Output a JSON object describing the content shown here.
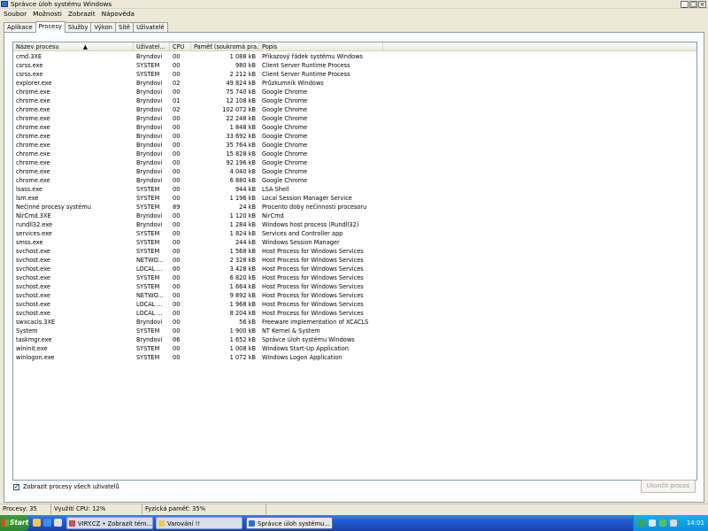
{
  "window": {
    "title": "Správce úloh systému Windows",
    "controls": [
      "_",
      "□",
      "×"
    ]
  },
  "menu": [
    "Soubor",
    "Možnosti",
    "Zobrazit",
    "Nápověda"
  ],
  "tabs": [
    {
      "label": "Aplikace"
    },
    {
      "label": "Procesy"
    },
    {
      "label": "Služby"
    },
    {
      "label": "Výkon"
    },
    {
      "label": "Sítě"
    },
    {
      "label": "Uživatelé"
    }
  ],
  "columns": {
    "name": "Název procesu",
    "sort_indicator": "▲",
    "user": "Uživatel...",
    "cpu": "CPU",
    "mem": "Paměť (soukromá pra...",
    "desc": "Popis"
  },
  "rows": [
    {
      "name": "cmd.3XE",
      "user": "Bryndovi",
      "cpu": "00",
      "mem": "1 088 kB",
      "desc": "Příkazový řádek systému Windows"
    },
    {
      "name": "csrss.exe",
      "user": "SYSTEM",
      "cpu": "00",
      "mem": "980 kB",
      "desc": "Client Server Runtime Process"
    },
    {
      "name": "csrss.exe",
      "user": "SYSTEM",
      "cpu": "00",
      "mem": "2 212 kB",
      "desc": "Client Server Runtime Process"
    },
    {
      "name": "explorer.exe",
      "user": "Bryndovi",
      "cpu": "02",
      "mem": "49 824 kB",
      "desc": "Průzkumník Windows"
    },
    {
      "name": "chrome.exe",
      "user": "Bryndovi",
      "cpu": "00",
      "mem": "75 740 kB",
      "desc": "Google Chrome"
    },
    {
      "name": "chrome.exe",
      "user": "Bryndovi",
      "cpu": "01",
      "mem": "12 108 kB",
      "desc": "Google Chrome"
    },
    {
      "name": "chrome.exe",
      "user": "Bryndovi",
      "cpu": "02",
      "mem": "102 072 kB",
      "desc": "Google Chrome"
    },
    {
      "name": "chrome.exe",
      "user": "Bryndovi",
      "cpu": "00",
      "mem": "22 248 kB",
      "desc": "Google Chrome"
    },
    {
      "name": "chrome.exe",
      "user": "Bryndovi",
      "cpu": "00",
      "mem": "1 848 kB",
      "desc": "Google Chrome"
    },
    {
      "name": "chrome.exe",
      "user": "Bryndovi",
      "cpu": "00",
      "mem": "33 692 kB",
      "desc": "Google Chrome"
    },
    {
      "name": "chrome.exe",
      "user": "Bryndovi",
      "cpu": "00",
      "mem": "35 764 kB",
      "desc": "Google Chrome"
    },
    {
      "name": "chrome.exe",
      "user": "Bryndovi",
      "cpu": "00",
      "mem": "15 828 kB",
      "desc": "Google Chrome"
    },
    {
      "name": "chrome.exe",
      "user": "Bryndovi",
      "cpu": "00",
      "mem": "92 196 kB",
      "desc": "Google Chrome"
    },
    {
      "name": "chrome.exe",
      "user": "Bryndovi",
      "cpu": "00",
      "mem": "4 040 kB",
      "desc": "Google Chrome"
    },
    {
      "name": "chrome.exe",
      "user": "Bryndovi",
      "cpu": "00",
      "mem": "6 880 kB",
      "desc": "Google Chrome"
    },
    {
      "name": "lsass.exe",
      "user": "SYSTEM",
      "cpu": "00",
      "mem": "944 kB",
      "desc": "LSA Shell"
    },
    {
      "name": "lsm.exe",
      "user": "SYSTEM",
      "cpu": "00",
      "mem": "1 196 kB",
      "desc": "Local Session Manager Service"
    },
    {
      "name": "Nečinné procesy systému",
      "user": "SYSTEM",
      "cpu": "89",
      "mem": "24 kB",
      "desc": "Procento doby nečinnosti procesoru"
    },
    {
      "name": "NirCmd.3XE",
      "user": "Bryndovi",
      "cpu": "00",
      "mem": "1 120 kB",
      "desc": "NirCmd"
    },
    {
      "name": "rundll32.exe",
      "user": "Bryndovi",
      "cpu": "00",
      "mem": "1 284 kB",
      "desc": "Windows host process (Rundll32)"
    },
    {
      "name": "services.exe",
      "user": "SYSTEM",
      "cpu": "00",
      "mem": "1 824 kB",
      "desc": "Services and Controller app"
    },
    {
      "name": "smss.exe",
      "user": "SYSTEM",
      "cpu": "00",
      "mem": "244 kB",
      "desc": "Windows Session Manager"
    },
    {
      "name": "svchost.exe",
      "user": "SYSTEM",
      "cpu": "00",
      "mem": "1 568 kB",
      "desc": "Host Process for Windows Services"
    },
    {
      "name": "svchost.exe",
      "user": "NETWO...",
      "cpu": "00",
      "mem": "2 328 kB",
      "desc": "Host Process for Windows Services"
    },
    {
      "name": "svchost.exe",
      "user": "LOCAL ...",
      "cpu": "00",
      "mem": "3 428 kB",
      "desc": "Host Process for Windows Services"
    },
    {
      "name": "svchost.exe",
      "user": "SYSTEM",
      "cpu": "00",
      "mem": "6 820 kB",
      "desc": "Host Process for Windows Services"
    },
    {
      "name": "svchost.exe",
      "user": "SYSTEM",
      "cpu": "00",
      "mem": "1 664 kB",
      "desc": "Host Process for Windows Services"
    },
    {
      "name": "svchost.exe",
      "user": "NETWO...",
      "cpu": "00",
      "mem": "9 892 kB",
      "desc": "Host Process for Windows Services"
    },
    {
      "name": "svchost.exe",
      "user": "LOCAL ...",
      "cpu": "00",
      "mem": "1 968 kB",
      "desc": "Host Process for Windows Services"
    },
    {
      "name": "svchost.exe",
      "user": "LOCAL ...",
      "cpu": "00",
      "mem": "8 204 kB",
      "desc": "Host Process for Windows Services"
    },
    {
      "name": "swxcacls.3XE",
      "user": "Bryndovi",
      "cpu": "00",
      "mem": "56 kB",
      "desc": "Freeware implementation of XCACLS"
    },
    {
      "name": "System",
      "user": "SYSTEM",
      "cpu": "00",
      "mem": "1 900 kB",
      "desc": "NT Kernel & System"
    },
    {
      "name": "taskmgr.exe",
      "user": "Bryndovi",
      "cpu": "06",
      "mem": "1 652 kB",
      "desc": "Správce úloh systému Windows"
    },
    {
      "name": "wininit.exe",
      "user": "SYSTEM",
      "cpu": "00",
      "mem": "1 008 kB",
      "desc": "Windows Start-Up Application"
    },
    {
      "name": "winlogon.exe",
      "user": "SYSTEM",
      "cpu": "00",
      "mem": "1 072 kB",
      "desc": "Windows Logon Application"
    }
  ],
  "show_all_users": {
    "checked": "✓",
    "label": "Zobrazit procesy všech uživatelů"
  },
  "end_process_button": "Ukončit proces",
  "status": {
    "processes": "Procesy: 35",
    "cpu": "Využití CPU: 12%",
    "memory": "Fyzická paměť: 35%"
  },
  "taskbar": {
    "start": "Start",
    "buttons": [
      {
        "label": "VIRY.CZ • Zobrazit tém...",
        "icon": "chrome-icon"
      },
      {
        "label": "Varování !!",
        "icon": "folder-icon"
      },
      {
        "label": "Správce úloh systému...",
        "icon": "taskmgr-icon"
      }
    ],
    "clock": "14:01"
  },
  "colors": {
    "selection_panel": "#fcfcfe",
    "taskbar": "#245edc",
    "start_button": "#2f8a2f",
    "tray": "#0a8ee0"
  }
}
